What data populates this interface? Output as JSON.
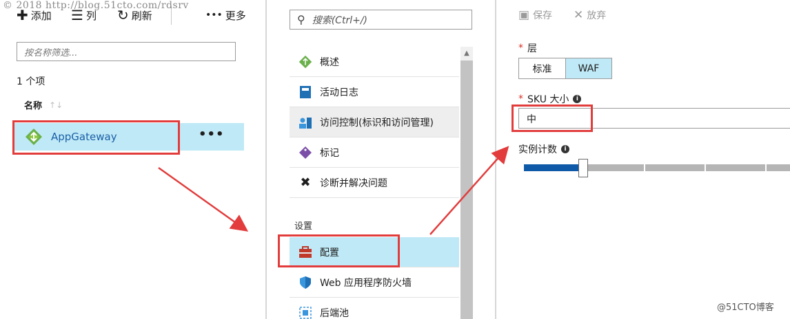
{
  "watermark_top": "© 2018 http://blog.51cto.com/rdsrv",
  "watermark_bottom": "@51CTO博客",
  "left_panel": {
    "toolbar": {
      "add_label": "添加",
      "columns_label": "列",
      "refresh_label": "刷新",
      "more_label": "更多"
    },
    "filter_placeholder": "按名称筛选...",
    "count_text": "1 个项",
    "column_header": "名称",
    "rows": [
      {
        "name": "AppGateway",
        "more": "•••"
      }
    ]
  },
  "middle_panel": {
    "search_placeholder": "搜索(Ctrl+/)",
    "menu_items": [
      {
        "label": "概述",
        "icon": "overview-icon"
      },
      {
        "label": "活动日志",
        "icon": "activity-log-icon"
      },
      {
        "label": "访问控制(标识和访问管理)",
        "icon": "access-control-icon"
      },
      {
        "label": "标记",
        "icon": "tag-icon"
      },
      {
        "label": "诊断并解决问题",
        "icon": "wrench-icon"
      }
    ],
    "section_label": "设置",
    "settings_items": [
      {
        "label": "配置",
        "icon": "configuration-icon"
      },
      {
        "label": "Web 应用程序防火墙",
        "icon": "shield-icon"
      },
      {
        "label": "后端池",
        "icon": "backend-pool-icon"
      }
    ]
  },
  "right_panel": {
    "save_label": "保存",
    "discard_label": "放弃",
    "tier_label": "层",
    "tier_options": [
      "标准",
      "WAF"
    ],
    "tier_selected": "WAF",
    "sku_label": "SKU 大小",
    "sku_value": "中",
    "instance_label": "实例计数",
    "instance_count": 2
  },
  "colors": {
    "selection_blue": "#bfe9f6",
    "link_blue": "#1b5fa8",
    "slider_blue": "#0f5aa8",
    "annotation_red": "#e23c3c",
    "required_red": "#d93025"
  }
}
